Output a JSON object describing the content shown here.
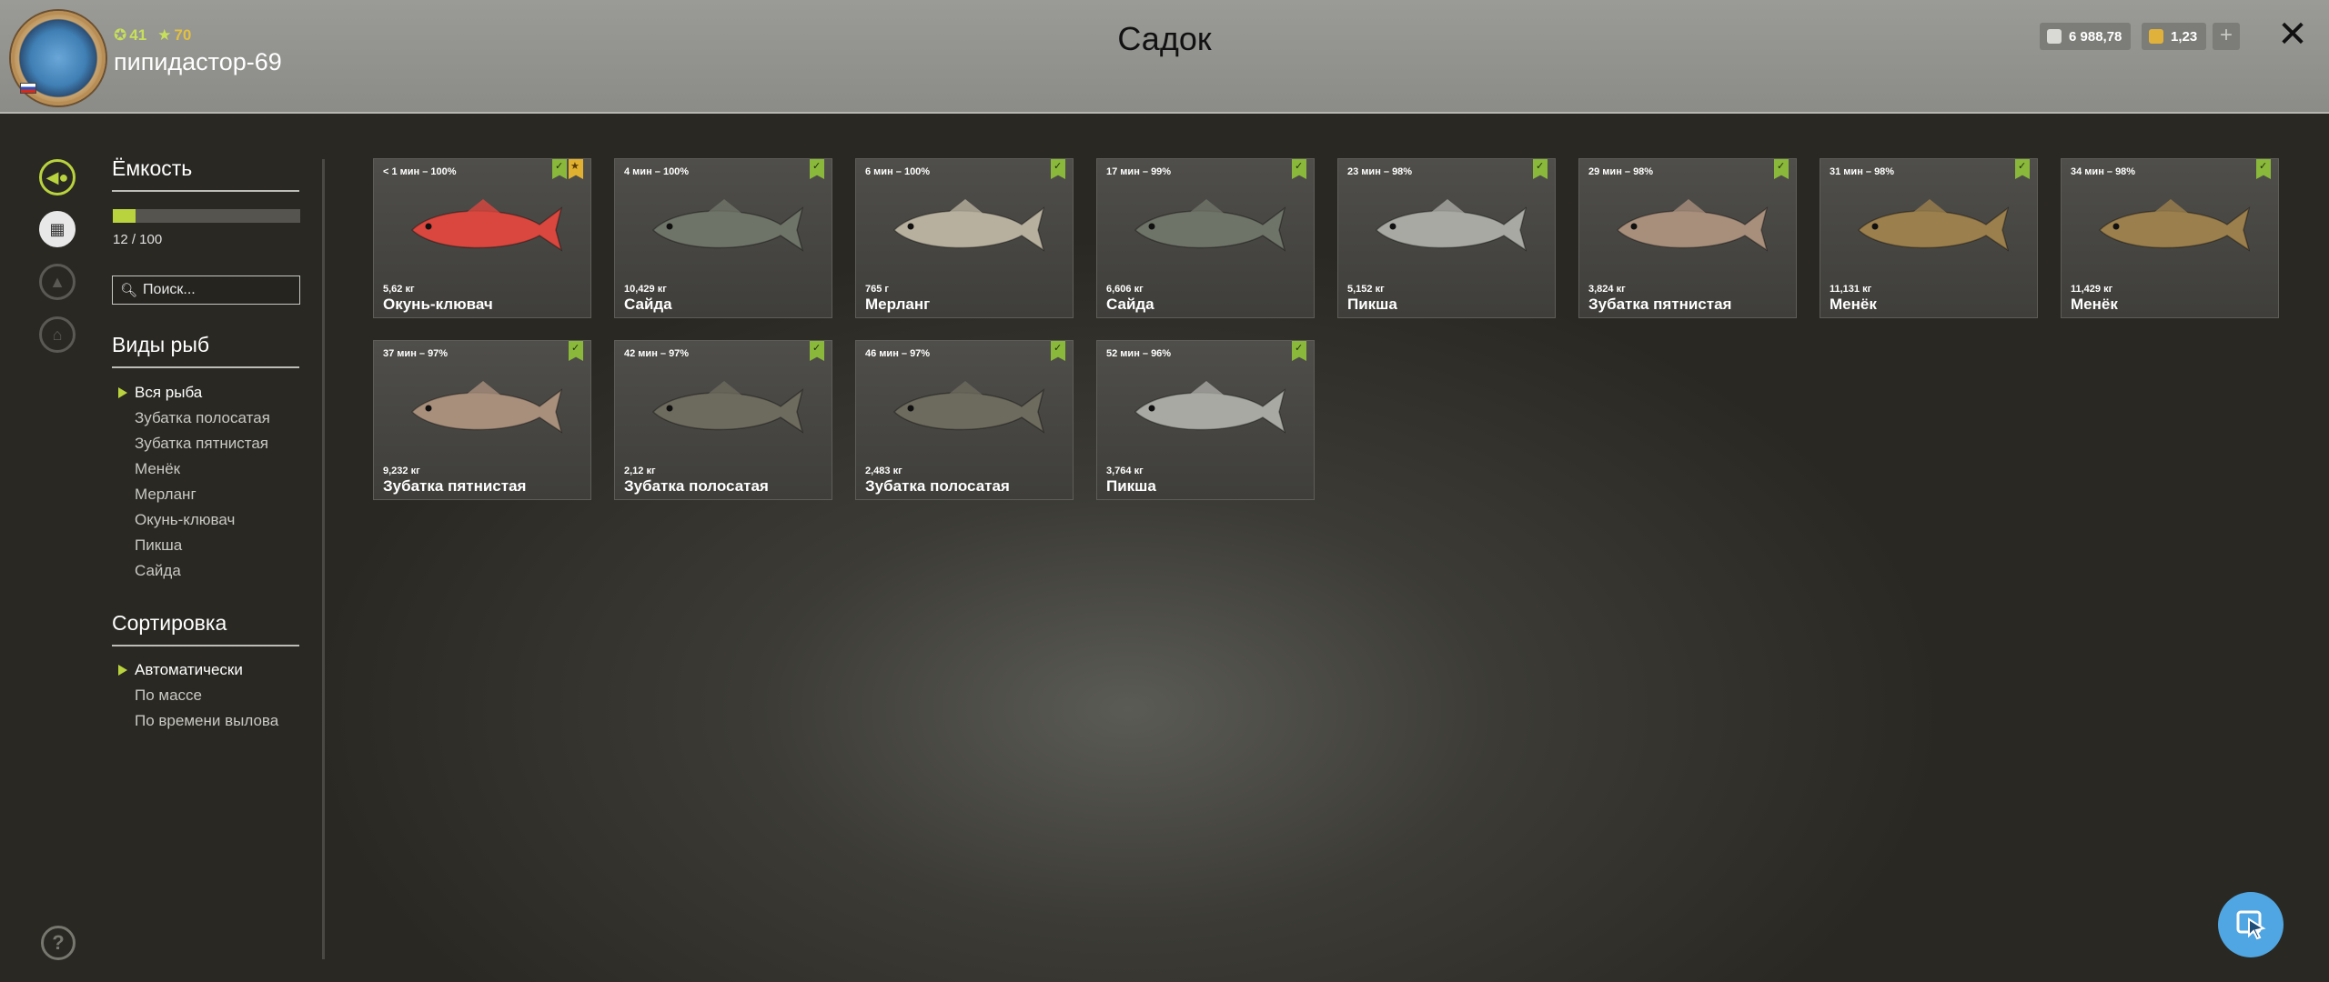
{
  "header": {
    "title": "Садок",
    "username": "пипидастор-69",
    "level": "41",
    "rank": "70",
    "silver": "6 988,78",
    "gold": "1,23"
  },
  "capacity": {
    "title": "Ёмкость",
    "text": "12 / 100",
    "fraction": 0.12
  },
  "search": {
    "placeholder": "Поиск..."
  },
  "species": {
    "title": "Виды рыб",
    "items": [
      "Вся рыба",
      "Зубатка полосатая",
      "Зубатка пятнистая",
      "Менёк",
      "Мерланг",
      "Окунь-клювач",
      "Пикша",
      "Сайда"
    ]
  },
  "sort": {
    "title": "Сортировка",
    "items": [
      "Автоматически",
      "По массе",
      "По времени вылова"
    ]
  },
  "fish": [
    {
      "time": "< 1 мин – 100%",
      "weight": "5,62 кг",
      "name": "Окунь-клювач",
      "color": "#d9473e",
      "trophy": true
    },
    {
      "time": "4 мин – 100%",
      "weight": "10,429 кг",
      "name": "Сайда",
      "color": "#6f7468",
      "trophy": false
    },
    {
      "time": "6 мин – 100%",
      "weight": "765 г",
      "name": "Мерланг",
      "color": "#b7b09e",
      "trophy": false
    },
    {
      "time": "17 мин – 99%",
      "weight": "6,606 кг",
      "name": "Сайда",
      "color": "#6f7468",
      "trophy": false
    },
    {
      "time": "23 мин – 98%",
      "weight": "5,152 кг",
      "name": "Пикша",
      "color": "#a9a9a4",
      "trophy": false
    },
    {
      "time": "29 мин – 98%",
      "weight": "3,824 кг",
      "name": "Зубатка пятнистая",
      "color": "#a88f7c",
      "trophy": false
    },
    {
      "time": "31 мин – 98%",
      "weight": "11,131 кг",
      "name": "Менёк",
      "color": "#9b7f4c",
      "trophy": false
    },
    {
      "time": "34 мин – 98%",
      "weight": "11,429 кг",
      "name": "Менёк",
      "color": "#9b7f4c",
      "trophy": false
    },
    {
      "time": "37 мин – 97%",
      "weight": "9,232 кг",
      "name": "Зубатка пятнистая",
      "color": "#a88f7c",
      "trophy": false
    },
    {
      "time": "42 мин – 97%",
      "weight": "2,12 кг",
      "name": "Зубатка полосатая",
      "color": "#6d6a5e",
      "trophy": false
    },
    {
      "time": "46 мин – 97%",
      "weight": "2,483 кг",
      "name": "Зубатка полосатая",
      "color": "#6d6a5e",
      "trophy": false
    },
    {
      "time": "52 мин – 96%",
      "weight": "3,764 кг",
      "name": "Пикша",
      "color": "#a9a9a4",
      "trophy": false
    }
  ]
}
